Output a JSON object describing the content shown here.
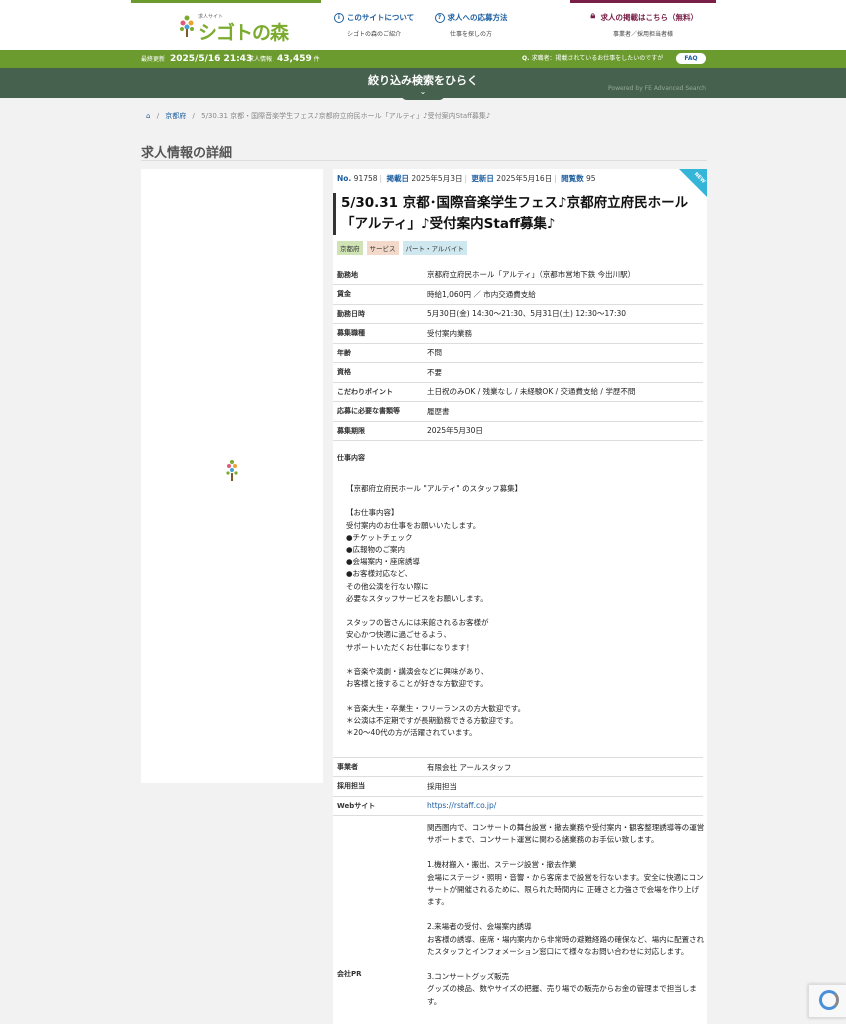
{
  "header": {
    "logo_small": "求人サイト",
    "logo_name": "シゴトの森",
    "nav": [
      {
        "label": "このサイトについて",
        "sub": "シゴトの森のご紹介",
        "icon": "info-icon"
      },
      {
        "label": "求人への応募方法",
        "sub": "仕事を探しの方",
        "icon": "question-icon"
      },
      {
        "label": "求人の掲載はこちら（無料）",
        "sub": "事業者／採用担当者様",
        "icon": "lock-icon"
      }
    ],
    "strip_colors": [
      "#6b9b2e",
      "#1d5fa0",
      "#7a2048"
    ]
  },
  "greenbar": {
    "updated_label": "最終更新",
    "updated_value": "2025/5/16 21:43",
    "jobs_label": "求人情報",
    "jobs_count": "43,459",
    "jobs_unit": "件",
    "seeker_text": "求職者：掲載されているお仕事をしたいのですが",
    "faq": "FAQ"
  },
  "searchbar": {
    "label": "絞り込み検索をひらく",
    "powered": "Powered by FE Advanced Search",
    "toggle": "⌄"
  },
  "breadcrumb": {
    "category": "京都府",
    "current": "5/30.31 京都・国際音楽学生フェス♪京都府立府民ホール「アルティ」♪受付案内Staff募集♪"
  },
  "page_title": "求人情報の詳細",
  "job": {
    "no_label": "No.",
    "no": "91758",
    "posted_label": "掲載日",
    "posted": "2025年5月3日",
    "updated_label": "更新日",
    "updated": "2025年5月16日",
    "views_label": "閲覧数",
    "views": "95",
    "new_badge": "NEW",
    "title": "5/30.31 京都･国際音楽学生フェス♪京都府立府民ホール「アルティ」♪受付案内Staff募集♪",
    "tags": [
      {
        "label": "京都府",
        "color": "#cfe3b4"
      },
      {
        "label": "サービス",
        "color": "#f3d9c9"
      },
      {
        "label": "パート・アルバイト",
        "color": "#cfe7ee"
      }
    ],
    "details": [
      {
        "key": "勤務地",
        "value": "京都府立府民ホール「アルティ」（京都市営地下鉄 今出川駅）"
      },
      {
        "key": "賃金",
        "value": "時給1,060円 ／ 市内交通費支給"
      },
      {
        "key": "勤務日時",
        "value": "5月30日(金) 14:30〜21:30、5月31日(土) 12:30〜17:30"
      },
      {
        "key": "募集職種",
        "value": "受付案内業務"
      },
      {
        "key": "年齢",
        "value": "不問"
      },
      {
        "key": "資格",
        "value": "不要"
      },
      {
        "key": "こだわりポイント",
        "value": "土日祝のみOK / 残業なし / 未経験OK / 交通費支給 / 学歴不問"
      },
      {
        "key": "応募に必要な書類等",
        "value": "履歴書"
      },
      {
        "key": "募集期限",
        "value": "2025年5月30日"
      }
    ],
    "content_label": "仕事内容",
    "content": "【京都府立府民ホール \"アルティ\" のスタッフ募集】\n\n【お仕事内容】\n受付案内のお仕事をお願いいたします。\n●チケットチェック\n●広報物のご案内\n●会場案内・座席誘導\n●お客様対応など、\nその他公演を行ない際に\n必要なスタッフサービスをお願いします。\n\nスタッフの皆さんには来館されるお客様が\n安心かつ快適に過ごせるよう、\nサポートいただくお仕事になります！\n\n＊音楽や演劇・講演会などに興味があり、\nお客様と接することが好きな方歓迎です。\n\n＊音楽大生・卒業生・フリーランスの方大歓迎です。\n＊公演は不定期ですが長期勤務できる方歓迎です。\n＊20〜40代の方が活躍されています。",
    "company": [
      {
        "key": "事業者",
        "value": "有限会社 アールスタッフ"
      },
      {
        "key": "採用担当",
        "value": "採用担当"
      },
      {
        "key": "Webサイト",
        "value": "https://rstaff.co.jp/"
      }
    ],
    "pr_label": "会社PR",
    "pr": "関西圏内で、コンサートの舞台設営・撤去業務や受付案内・観客整理誘導等の運営サポートまで、コンサート運営に関わる諸業務のお手伝い致します。\n\n1.機材搬入・搬出、ステージ設営・撤去作業\n会場にステージ・照明・音響・から客席まで設営を行ないます。安全に快適にコンサートが開催されるために、限られた時間内に 正確さと力強さで会場を作り上げます。\n\n2.来場者の受付、会場案内誘導\nお客様の誘導、座席・場内案内から非常時の避難経路の確保など、場内に配置されたスタッフとインフォメーション窓口にて様々なお問い合わせに対応します。\n\n3.コンサートグッズ販売\nグッズの検品、数やサイズの把握、売り場での販売からお金の管理まで担当します。"
  }
}
